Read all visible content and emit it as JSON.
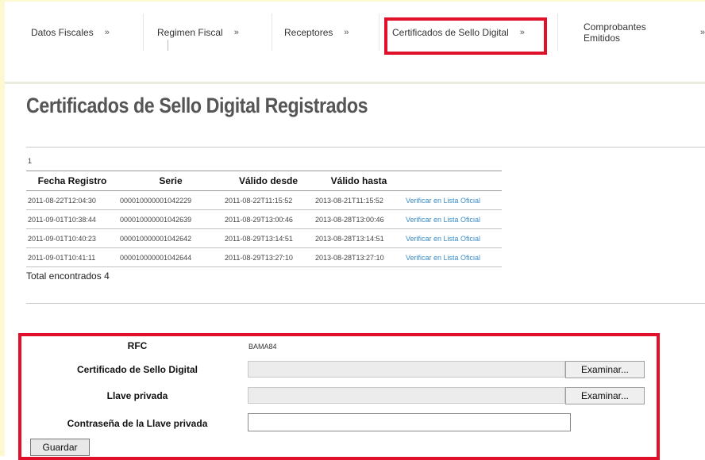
{
  "tabs": [
    {
      "label": "Datos Fiscales",
      "chevron": "»"
    },
    {
      "label": "Regimen Fiscal",
      "chevron": "»"
    },
    {
      "label": "Receptores",
      "chevron": "»"
    },
    {
      "label": "Certificados de Sello Digital",
      "chevron": "»"
    },
    {
      "label": "Comprobantes Emitidos",
      "chevron": "»"
    }
  ],
  "heading": "Certificados de Sello Digital Registrados",
  "table": {
    "page_number": "1",
    "columns": [
      "Fecha Registro",
      "Serie",
      "Válido desde",
      "Válido hasta",
      ""
    ],
    "rows": [
      [
        "2011-08-22T12:04:30",
        "000010000001042229",
        "2011-08-22T11:15:52",
        "2013-08-21T11:15:52",
        "Verificar en Lista Oficial"
      ],
      [
        "2011-09-01T10:38:44",
        "000010000001042639",
        "2011-08-29T13:00:46",
        "2013-08-28T13:00:46",
        "Verificar en Lista Oficial"
      ],
      [
        "2011-09-01T10:40:23",
        "000010000001042642",
        "2011-08-29T13:14:51",
        "2013-08-28T13:14:51",
        "Verificar en Lista Oficial"
      ],
      [
        "2011-09-01T10:41:11",
        "000010000001042644",
        "2011-08-29T13:27:10",
        "2013-08-28T13:27:10",
        "Verificar en Lista Oficial"
      ]
    ],
    "total": "Total encontrados 4"
  },
  "form": {
    "rfc_label": "RFC",
    "rfc_value": "BAMA84",
    "cert_label": "Certificado de Sello Digital",
    "cert_value": "",
    "key_label": "Llave privada",
    "key_value": "",
    "browse_label": "Examinar...",
    "password_label": "Contraseña de la Llave privada",
    "password_value": "",
    "save_label": "Guardar"
  },
  "colors": {
    "highlight": "#e0102a",
    "link": "#3a8dc8",
    "heading": "#555555"
  }
}
